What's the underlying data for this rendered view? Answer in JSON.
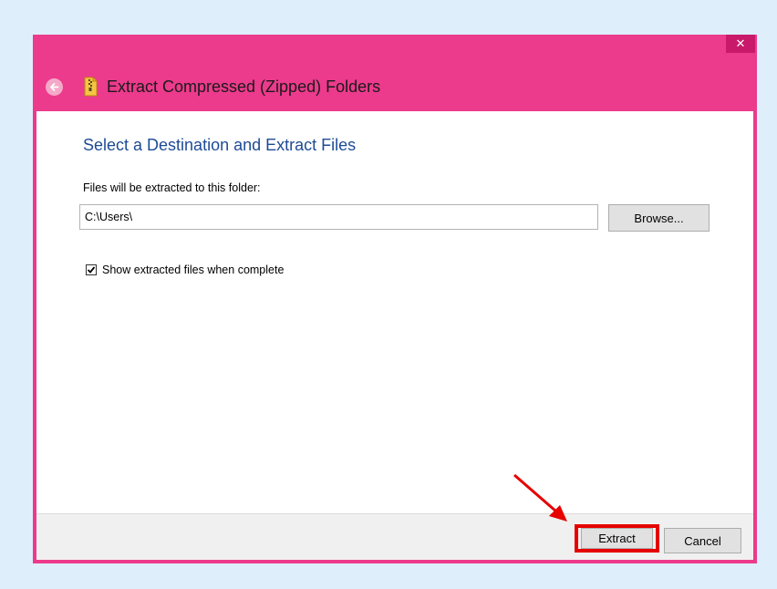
{
  "window": {
    "title": "Extract Compressed (Zipped) Folders",
    "close_symbol": "✕"
  },
  "content": {
    "heading": "Select a Destination and Extract Files",
    "destination_label": "Files will be extracted to this folder:",
    "destination_path": "C:\\Users\\",
    "browse_label": "Browse...",
    "show_files_label": "Show extracted files when complete",
    "show_files_checked": true
  },
  "footer": {
    "extract_label": "Extract",
    "cancel_label": "Cancel"
  },
  "colors": {
    "title_bar": "#ec3a8c",
    "heading": "#1e4b96",
    "annotation": "#e60000"
  },
  "icons": [
    "back-arrow-icon",
    "zip-folder-icon",
    "close-icon",
    "checkmark-icon"
  ]
}
